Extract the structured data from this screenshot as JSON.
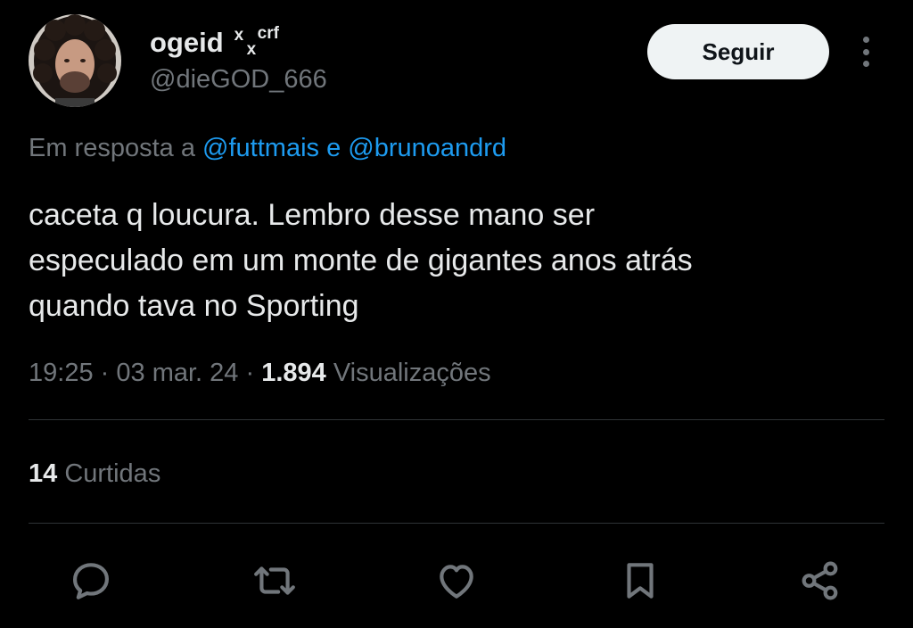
{
  "author": {
    "display_name": "ogeid",
    "name_deco_top": "x",
    "name_deco_bottom": "x",
    "name_deco_suffix": "crf",
    "handle": "@dieGOD_666"
  },
  "follow_label": "Seguir",
  "reply_to": {
    "prefix": "Em resposta a",
    "user1": "@futtmais",
    "conjunction": "e",
    "user2": "@brunoandrd"
  },
  "tweet": {
    "lines": [
      "caceta q loucura. Lembro desse mano ser",
      "especulado em um monte de gigantes anos atrás",
      "quando tava no Sporting"
    ]
  },
  "meta": {
    "time": "19:25",
    "separator": "·",
    "date": "03 mar. 24",
    "views_count": "1.894",
    "views_label": "Visualizações"
  },
  "stats": {
    "likes_count": "14",
    "likes_label": "Curtidas"
  },
  "actions": [
    "reply-icon",
    "retweet-icon",
    "like-icon",
    "bookmark-icon",
    "share-icon"
  ],
  "colors": {
    "background": "#000000",
    "text": "#e7e9ea",
    "secondary": "#71767b",
    "link": "#1d9bf0",
    "divider": "#2f3336",
    "button_bg": "#eff3f4"
  }
}
